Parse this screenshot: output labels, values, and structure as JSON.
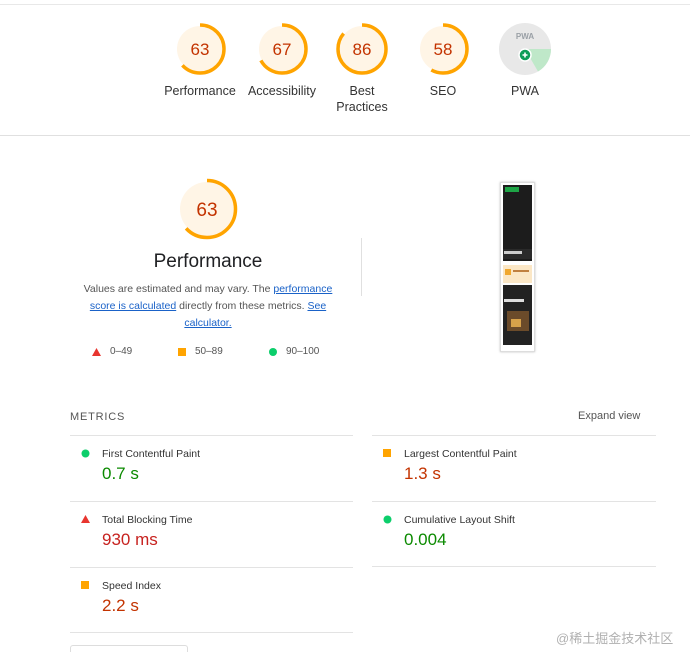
{
  "summary": {
    "gauges": [
      {
        "score": "63",
        "label": "Performance",
        "fraction": 0.63
      },
      {
        "score": "67",
        "label": "Accessibility",
        "fraction": 0.67
      },
      {
        "score": "86",
        "label": "Best Practices",
        "fraction": 0.86
      },
      {
        "score": "58",
        "label": "SEO",
        "fraction": 0.58
      }
    ],
    "pwa": {
      "badge_text": "PWA",
      "label": "PWA",
      "icon": "plus-badge-icon"
    }
  },
  "performance": {
    "score": "63",
    "fraction": 0.63,
    "title": "Performance",
    "desc_prefix": "Values are estimated and may vary. The ",
    "desc_link1": "performance score is calculated",
    "desc_middle": " directly from these metrics. ",
    "desc_link2": "See calculator.",
    "legend": [
      {
        "range": "0–49",
        "icon": "fail-triangle-icon"
      },
      {
        "range": "50–89",
        "icon": "average-square-icon"
      },
      {
        "range": "90–100",
        "icon": "pass-circle-icon"
      }
    ]
  },
  "metrics": {
    "heading": "METRICS",
    "expand_label": "Expand view",
    "items": [
      {
        "title": "First Contentful Paint",
        "value": "0.7 s",
        "status": "pass"
      },
      {
        "title": "Largest Contentful Paint",
        "value": "1.3 s",
        "status": "average"
      },
      {
        "title": "Total Blocking Time",
        "value": "930 ms",
        "status": "fail"
      },
      {
        "title": "Cumulative Layout Shift",
        "value": "0.004",
        "status": "pass"
      },
      {
        "title": "Speed Index",
        "value": "2.2 s",
        "status": "average"
      }
    ]
  },
  "colors": {
    "pass": "#0b8a00",
    "pass_icon": "#0cce6b",
    "average": "#c33300",
    "average_icon": "#ffa400",
    "fail": "#c7221f",
    "fail_icon": "#e8352f",
    "gauge_text": "#c33300",
    "gauge_arc": "#ffa400",
    "gauge_bg": "#fff5e6"
  },
  "watermark": "@稀土掘金技术社区"
}
